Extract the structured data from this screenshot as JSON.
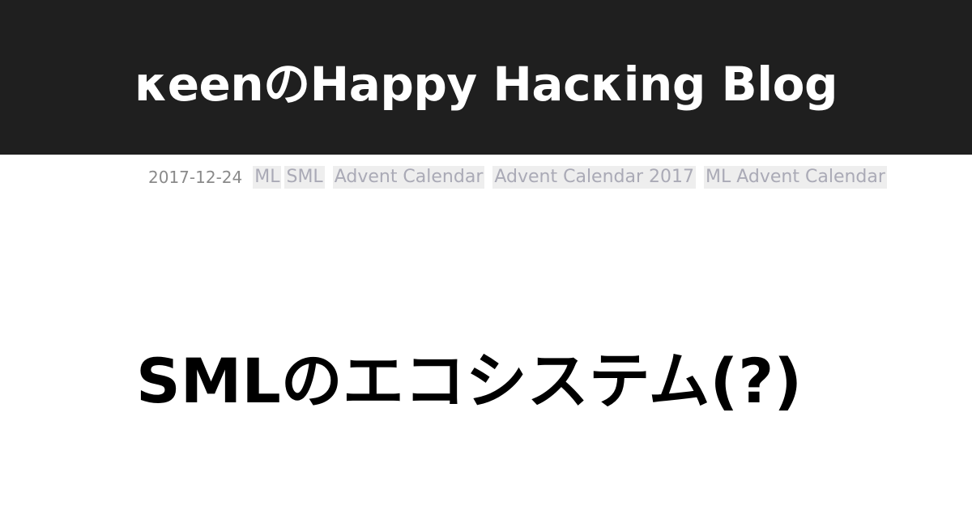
{
  "header": {
    "site_title": "κeenのHappy Hacκing Blog"
  },
  "meta": {
    "date": "2017-12-24",
    "tags": [
      "ML",
      "SML",
      "Advent Calendar",
      "Advent Calendar 2017",
      "ML Advent Calendar"
    ]
  },
  "post": {
    "title": "SMLのエコシステム(?)"
  },
  "colors": {
    "header_bg": "#1f1f1f",
    "tag_text": "#aaaab6",
    "tag_bg": "#eeeeee"
  }
}
